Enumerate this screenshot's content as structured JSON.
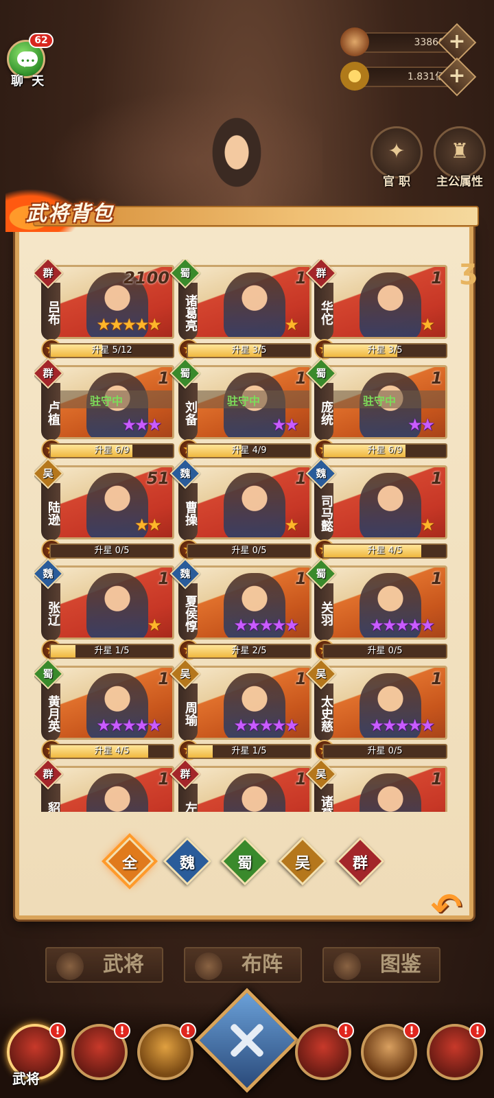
{
  "hud": {
    "chat_badge": "62",
    "chat_label": "聊 天",
    "resource_1_value": "33860",
    "resource_2_value": "1.831亿",
    "side_button_1": "官 职",
    "side_button_2": "主公属性"
  },
  "panel": {
    "title": "武将背包"
  },
  "factions": {
    "qun": "群",
    "shu": "蜀",
    "wu": "吴",
    "wei": "魏",
    "all": "全"
  },
  "colors": {
    "qun": "#a3262a",
    "shu": "#3a8a2c",
    "wu": "#b5771c",
    "wei": "#2a5c9a",
    "all": "#e07a1c"
  },
  "heroes": [
    {
      "faction": "群",
      "faction_key": "qun",
      "name": "吕布",
      "count": "2100",
      "stars": 5,
      "star_color": "gold",
      "progress_label": "升星 5/12",
      "progress": 0.42
    },
    {
      "faction": "蜀",
      "faction_key": "shu",
      "name": "诸葛亮",
      "count": "1",
      "stars": 1,
      "star_color": "gold",
      "progress_label": "升星 3/5",
      "progress": 0.6
    },
    {
      "faction": "群",
      "faction_key": "qun",
      "name": "华佗",
      "count": "1",
      "stars": 1,
      "star_color": "gold",
      "progress_label": "升星 3/5",
      "progress": 0.6
    },
    {
      "faction": "群",
      "faction_key": "qun",
      "name": "卢植",
      "count": "1",
      "stars": 3,
      "star_color": "purple",
      "progress_label": "升星 6/9",
      "progress": 0.67,
      "garrison": "驻守中"
    },
    {
      "faction": "蜀",
      "faction_key": "shu",
      "name": "刘备",
      "count": "1",
      "stars": 2,
      "star_color": "purple",
      "progress_label": "升星 4/9",
      "progress": 0.44,
      "garrison": "驻守中"
    },
    {
      "faction": "蜀",
      "faction_key": "shu",
      "name": "庞统",
      "count": "1",
      "stars": 2,
      "star_color": "purple",
      "progress_label": "升星 6/9",
      "progress": 0.67,
      "garrison": "驻守中"
    },
    {
      "faction": "吴",
      "faction_key": "wu",
      "name": "陆逊",
      "count": "51",
      "stars": 2,
      "star_color": "gold",
      "progress_label": "升星 0/5",
      "progress": 0
    },
    {
      "faction": "魏",
      "faction_key": "wei",
      "name": "曹操",
      "count": "1",
      "stars": 1,
      "star_color": "gold",
      "progress_label": "升星 0/5",
      "progress": 0
    },
    {
      "faction": "魏",
      "faction_key": "wei",
      "name": "司马懿",
      "count": "1",
      "stars": 1,
      "star_color": "gold",
      "progress_label": "升星 4/5",
      "progress": 0.8
    },
    {
      "faction": "魏",
      "faction_key": "wei",
      "name": "张辽",
      "count": "1",
      "stars": 1,
      "star_color": "gold",
      "progress_label": "升星 1/5",
      "progress": 0.2
    },
    {
      "faction": "魏",
      "faction_key": "wei",
      "name": "夏侯惇",
      "count": "1",
      "stars": 5,
      "star_color": "purple",
      "progress_label": "升星 2/5",
      "progress": 0.4
    },
    {
      "faction": "蜀",
      "faction_key": "shu",
      "name": "关羽",
      "count": "1",
      "stars": 5,
      "star_color": "purple",
      "progress_label": "升星 0/5",
      "progress": 0
    },
    {
      "faction": "蜀",
      "faction_key": "shu",
      "name": "黄月英",
      "count": "1",
      "stars": 5,
      "star_color": "purple",
      "progress_label": "升星 4/5",
      "progress": 0.8
    },
    {
      "faction": "吴",
      "faction_key": "wu",
      "name": "周瑜",
      "count": "1",
      "stars": 5,
      "star_color": "purple",
      "progress_label": "升星 1/5",
      "progress": 0.2
    },
    {
      "faction": "吴",
      "faction_key": "wu",
      "name": "太史慈",
      "count": "1",
      "stars": 5,
      "star_color": "purple",
      "progress_label": "升星 0/5",
      "progress": 0
    },
    {
      "faction": "群",
      "faction_key": "qun",
      "name": "貂蝉",
      "count": "1",
      "stars": 0,
      "star_color": "gold",
      "progress_label": "",
      "progress": 0
    },
    {
      "faction": "群",
      "faction_key": "qun",
      "name": "左慈",
      "count": "1",
      "stars": 0,
      "star_color": "gold",
      "progress_label": "",
      "progress": 0
    },
    {
      "faction": "吴",
      "faction_key": "wu",
      "name": "诸葛瑾",
      "count": "1",
      "stars": 0,
      "star_color": "gold",
      "progress_label": "",
      "progress": 0
    }
  ],
  "filters": [
    {
      "label": "全",
      "key": "all",
      "active": true
    },
    {
      "label": "魏",
      "key": "wei",
      "active": false
    },
    {
      "label": "蜀",
      "key": "shu",
      "active": false
    },
    {
      "label": "吴",
      "key": "wu",
      "active": false
    },
    {
      "label": "群",
      "key": "qun",
      "active": false
    }
  ],
  "tabs": {
    "generals": "武将",
    "formation": "布阵",
    "codex": "图鉴"
  },
  "bottom_nav": {
    "active_label": "武将",
    "alert_mark": "!"
  },
  "icons": {
    "resource_1": "scroll-icon",
    "resource_2": "coin-icon",
    "plus": "+",
    "back": "↶"
  }
}
